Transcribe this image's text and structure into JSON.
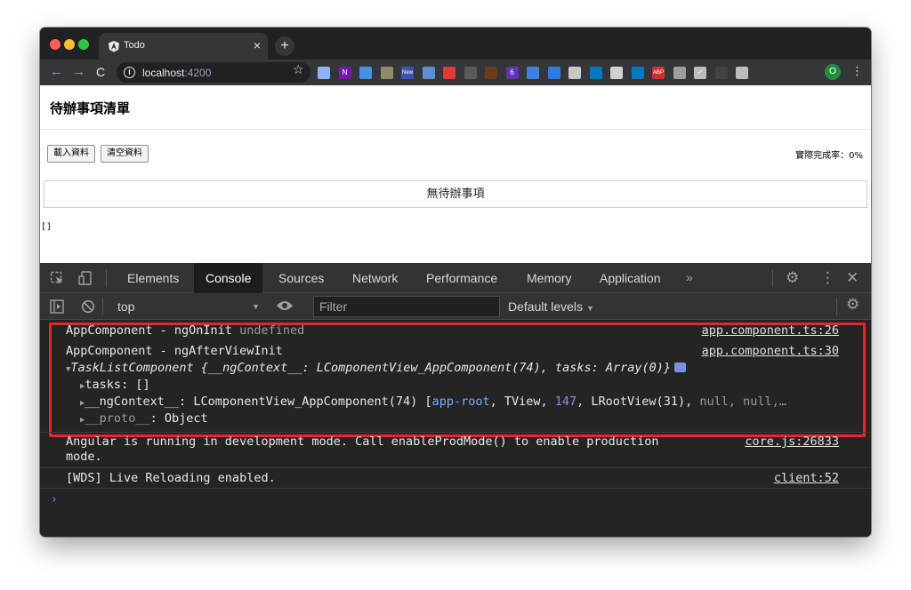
{
  "browser": {
    "tab_title": "Todo",
    "tab_close": "×",
    "new_tab": "+",
    "url_host": "localhost",
    "url_port": ":4200",
    "avatar_letter": "O",
    "extensions": [
      {
        "name": "gem-ext-icon",
        "color": "#8ab4f8",
        "text": ""
      },
      {
        "name": "onenote-icon",
        "color": "#7719aa",
        "text": "N"
      },
      {
        "name": "compass-icon",
        "color": "#4a90e2",
        "text": ""
      },
      {
        "name": "leaf-icon",
        "color": "#8d8d6a",
        "text": ""
      },
      {
        "name": "new-badge-icon",
        "color": "#3f51b5",
        "text": "New"
      },
      {
        "name": "mail-icon",
        "color": "#5f8dd3",
        "text": ""
      },
      {
        "name": "block-icon",
        "color": "#e53935",
        "text": ""
      },
      {
        "name": "crop-icon",
        "color": "#5a5a5a",
        "text": ""
      },
      {
        "name": "owl-icon",
        "color": "#6b3b1b",
        "text": ""
      },
      {
        "name": "badge-six-icon",
        "color": "#5e35b1",
        "text": "6"
      },
      {
        "name": "screenshot-icon",
        "color": "#3f7fe0",
        "text": ""
      },
      {
        "name": "window-icon",
        "color": "#2d7be0",
        "text": ""
      },
      {
        "name": "bulb-icon",
        "color": "#c8c8c8",
        "text": ""
      },
      {
        "name": "trello-icon",
        "color": "#0079bf",
        "text": ""
      },
      {
        "name": "board-icon",
        "color": "#d0d0d0",
        "text": ""
      },
      {
        "name": "trello-alt-icon",
        "color": "#0079bf",
        "text": ""
      },
      {
        "name": "abp-icon",
        "color": "#d32f2f",
        "text": "ABP"
      },
      {
        "name": "image-ext-icon",
        "color": "#9e9e9e",
        "text": ""
      },
      {
        "name": "check-ext-icon",
        "color": "#bdbdbd",
        "text": "✓"
      },
      {
        "name": "phone-ext-icon",
        "color": "#424242",
        "text": ""
      },
      {
        "name": "puzzle-icon",
        "color": "#bdbdbd",
        "text": ""
      }
    ]
  },
  "page": {
    "title": "待辦事項清單",
    "load_button": "載入資料",
    "clear_button": "清空資料",
    "completion_rate": "實際完成率：0%",
    "empty_message": "無待辦事項",
    "json_output": "[]"
  },
  "devtools": {
    "tabs": [
      "Elements",
      "Console",
      "Sources",
      "Network",
      "Performance",
      "Memory",
      "Application"
    ],
    "active_tab": "Console",
    "more_tabs": "»",
    "context": "top",
    "filter_placeholder": "Filter",
    "levels": "Default levels",
    "messages": {
      "m1_text": "AppComponent - ngOnInit ",
      "m1_value": "undefined",
      "m1_source": "app.component.ts:26",
      "m2_text": "AppComponent - ngAfterViewInit",
      "m2_source": "app.component.ts:30",
      "obj_summary": "TaskListComponent {__ngContext__: LComponentView_AppComponent(74), tasks: Array(0)}",
      "tasks_key": "tasks",
      "tasks_value": ": []",
      "ctx_key": "__ngContext__",
      "ctx_value_prefix": ": LComponentView_AppComponent(74) [",
      "ctx_approot": "app-root",
      "ctx_tview": ", TView, ",
      "ctx_num": "147",
      "ctx_rest": ", LRootView(31), ",
      "ctx_nulls": "null, null,…",
      "proto_key": "__proto__",
      "proto_value": ": Object",
      "m3_line1": "Angular is running in development mode. Call enableProdMode() to enable production",
      "m3_line2": "mode.",
      "m3_source": "core.js:26833",
      "m4_text": "[WDS] Live Reloading enabled.",
      "m4_source": "client:52",
      "prompt": "›"
    }
  }
}
